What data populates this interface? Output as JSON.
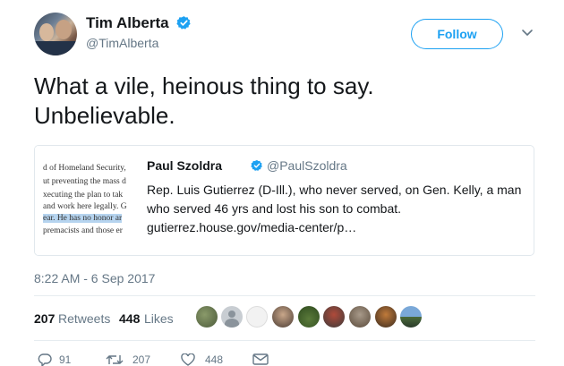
{
  "header": {
    "name": "Tim Alberta",
    "handle": "@TimAlberta",
    "follow_label": "Follow"
  },
  "tweet": {
    "text_line1": "What a vile, heinous thing to say.",
    "text_line2": "Unbelievable."
  },
  "quote": {
    "name": "Paul Szoldra",
    "handle": "@PaulSzoldra",
    "text_line1": "Rep. Luis Gutierrez (D-Ill.), who never served, on Gen. Kelly, a man",
    "text_line2": "who served 46 yrs and lost his son to combat.",
    "text_line3": "gutierrez.house.gov/media-center/p…",
    "thumb_lines": [
      "d of Homeland Security,",
      "ut preventing the mass d",
      "xecuting the plan to tak",
      "and work here legally. G",
      "ear. He has no honor ar",
      "premacists and those er"
    ]
  },
  "timestamp": "8:22 AM - 6 Sep 2017",
  "stats": {
    "retweets_count": "207",
    "retweets_label": "Retweets",
    "likes_count": "448",
    "likes_label": "Likes"
  },
  "actions": {
    "replies": "91",
    "retweets": "207",
    "likes": "448"
  },
  "icons": {
    "verified": "verified-badge-icon",
    "chevron": "chevron-down-icon",
    "reply": "reply-icon",
    "retweet": "retweet-icon",
    "like": "heart-icon",
    "dm": "envelope-icon"
  },
  "colors": {
    "accent": "#1da1f2",
    "secondary_text": "#657786",
    "primary_text": "#14171a",
    "border": "#e1e8ed"
  }
}
